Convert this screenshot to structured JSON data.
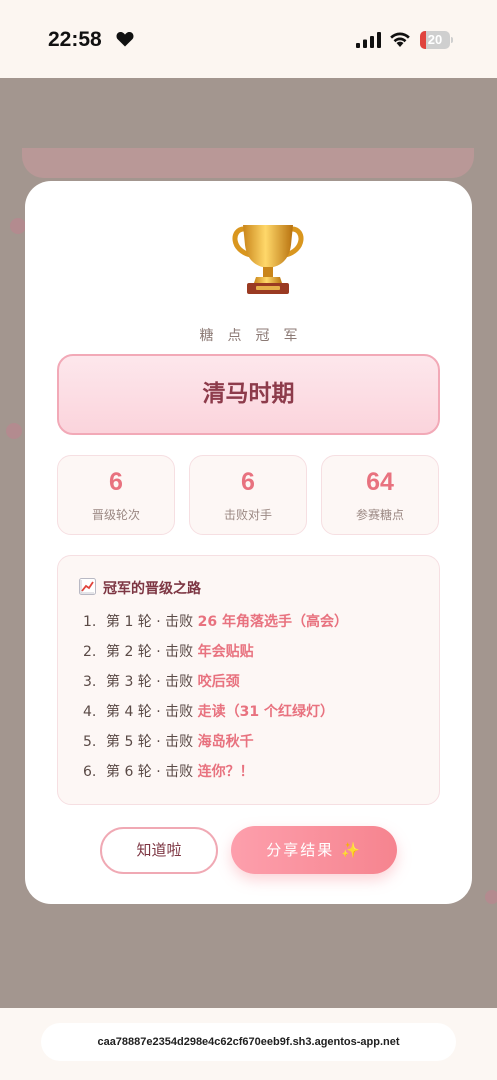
{
  "status_bar": {
    "time": "22:58",
    "battery": "20",
    "battery_fraction": 0.2
  },
  "modal": {
    "subtitle": "糖点冠军",
    "champion": "清马时期",
    "stats": [
      {
        "value": "6",
        "label": "晋级轮次"
      },
      {
        "value": "6",
        "label": "击败对手"
      },
      {
        "value": "64",
        "label": "参赛糖点"
      }
    ],
    "path_title": "冠军的晋级之路",
    "rounds": [
      {
        "num": "1.",
        "prefix": "第 1 轮 · 击败 ",
        "opponent": "26 年角落选手（高会）"
      },
      {
        "num": "2.",
        "prefix": "第 2 轮 · 击败 ",
        "opponent": "年会贴贴"
      },
      {
        "num": "3.",
        "prefix": "第 3 轮 · 击败 ",
        "opponent": "咬后颈"
      },
      {
        "num": "4.",
        "prefix": "第 4 轮 · 击败 ",
        "opponent": "走读（31 个红绿灯）"
      },
      {
        "num": "5.",
        "prefix": "第 5 轮 · 击败 ",
        "opponent": "海岛秋千"
      },
      {
        "num": "6.",
        "prefix": "第 6 轮 · 击败 ",
        "opponent": "连你？！"
      }
    ],
    "ok_button": "知道啦",
    "share_button": "分享结果 ✨"
  },
  "browser": {
    "url": "caa78887e2354d298e4c62cf670eeb9f.sh3.agentos-app.net"
  },
  "colors": {
    "accent": "#e8727f",
    "dark_rose": "#8d3b4b"
  }
}
